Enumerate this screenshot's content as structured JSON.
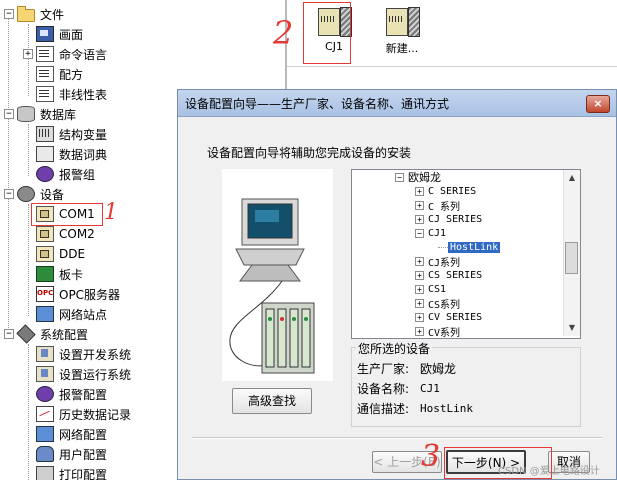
{
  "tree": {
    "items": [
      {
        "label": "文件",
        "icon": "folder-icon",
        "level": 0,
        "expander": "−"
      },
      {
        "label": "画面",
        "icon": "screen-icon",
        "level": 1
      },
      {
        "label": "命令语言",
        "icon": "document-icon",
        "level": 1,
        "expander": "+"
      },
      {
        "label": "配方",
        "icon": "recipe-icon",
        "level": 1
      },
      {
        "label": "非线性表",
        "icon": "document-icon",
        "level": 1
      },
      {
        "label": "数据库",
        "icon": "database-icon",
        "level": 0,
        "expander": "−"
      },
      {
        "label": "结构变量",
        "icon": "grid-icon",
        "level": 1
      },
      {
        "label": "数据词典",
        "icon": "book-icon",
        "level": 1
      },
      {
        "label": "报警组",
        "icon": "alarm-icon",
        "level": 1
      },
      {
        "label": "设备",
        "icon": "gears-icon",
        "level": 0,
        "expander": "−"
      },
      {
        "label": "COM1",
        "icon": "serial-port-icon",
        "level": 1
      },
      {
        "label": "COM2",
        "icon": "serial-port-icon",
        "level": 1
      },
      {
        "label": "DDE",
        "icon": "dde-icon",
        "level": 1
      },
      {
        "label": "板卡",
        "icon": "card-icon",
        "level": 1
      },
      {
        "label": "OPC服务器",
        "icon": "opc-icon",
        "level": 1
      },
      {
        "label": "网络站点",
        "icon": "network-icon",
        "level": 1
      },
      {
        "label": "系统配置",
        "icon": "tools-icon",
        "level": 0,
        "expander": "−"
      },
      {
        "label": "设置开发系统",
        "icon": "config-icon",
        "level": 1
      },
      {
        "label": "设置运行系统",
        "icon": "config-icon",
        "level": 1
      },
      {
        "label": "报警配置",
        "icon": "alarm-icon",
        "level": 1
      },
      {
        "label": "历史数据记录",
        "icon": "history-icon",
        "level": 1
      },
      {
        "label": "网络配置",
        "icon": "network-icon",
        "level": 1
      },
      {
        "label": "用户配置",
        "icon": "user-icon",
        "level": 1
      },
      {
        "label": "打印配置",
        "icon": "printer-icon",
        "level": 1
      }
    ]
  },
  "devices": [
    {
      "label": "CJ1",
      "icon": "plc-device-icon"
    },
    {
      "label": "新建...",
      "icon": "plc-device-icon"
    }
  ],
  "dialog": {
    "title": "设备配置向导——生产厂家、设备名称、通讯方式",
    "close_label": "×",
    "intro": "设备配置向导将辅助您完成设备的安装",
    "list": [
      {
        "label": "欧姆龙",
        "expander": "−",
        "level": 0
      },
      {
        "label": "C SERIES",
        "expander": "+",
        "level": 1
      },
      {
        "label": "C 系列",
        "expander": "+",
        "level": 1
      },
      {
        "label": "CJ SERIES",
        "expander": "+",
        "level": 1
      },
      {
        "label": "CJ1",
        "expander": "−",
        "level": 1
      },
      {
        "label": "HostLink",
        "level": 2,
        "selected": true
      },
      {
        "label": "CJ系列",
        "expander": "+",
        "level": 1
      },
      {
        "label": "CS SERIES",
        "expander": "+",
        "level": 1
      },
      {
        "label": "CS1",
        "expander": "+",
        "level": 1
      },
      {
        "label": "CS系列",
        "expander": "+",
        "level": 1
      },
      {
        "label": "CV SERIES",
        "expander": "+",
        "level": 1
      },
      {
        "label": "CV系列",
        "expander": "+",
        "level": 1
      }
    ],
    "selected_device": {
      "title": "您所选的设备",
      "manufacturer_label": "生产厂家:",
      "manufacturer": "欧姆龙",
      "device_name_label": "设备名称:",
      "device_name": "CJ1",
      "comm_label": "通信描述:",
      "comm": "HostLink"
    },
    "advanced_button": "高级查找",
    "back_button": "< 上一步(B)",
    "next_button": "下一步(N) >",
    "cancel_button": "取消"
  },
  "annotations": [
    "1",
    "2",
    "3"
  ],
  "watermark": "CSDN @爱上电路设计",
  "colors": {
    "highlight_box": "#e53935",
    "selection": "#316ac5"
  }
}
